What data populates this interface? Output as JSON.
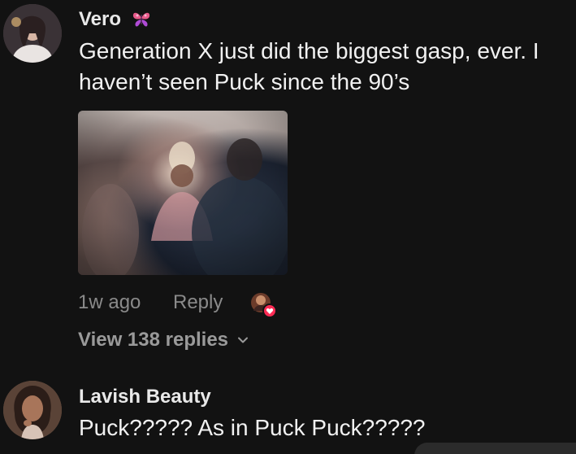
{
  "comments": [
    {
      "username": "Vero",
      "badge_icon": "butterfly-icon",
      "text": "Generation X just did the biggest gasp, ever. I haven’t seen Puck since the 90’s",
      "has_image": true,
      "time": "1w ago",
      "reply_label": "Reply",
      "creator_liked_icon": "creator-heart-icon",
      "view_replies_label": "View 138 replies"
    },
    {
      "username": "Lavish Beauty",
      "text": "Puck????? As in Puck Puck?????"
    }
  ],
  "colors": {
    "background": "#121212",
    "text_primary": "#f1f1f1",
    "text_secondary": "#8a8a8a",
    "like_heart": "#fe2c55"
  }
}
